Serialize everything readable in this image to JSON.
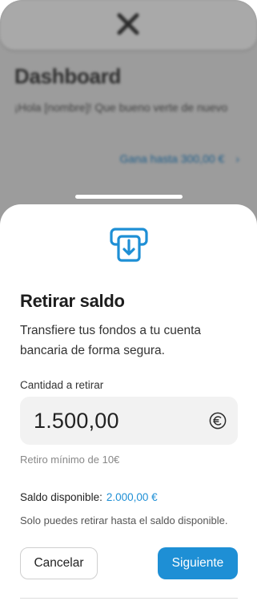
{
  "background": {
    "title": "Dashboard",
    "greeting": "¡Hola [nombre]! Que bueno verte de nuevo",
    "promo_link": "Gana hasta 300,00 €",
    "promo_chevron": "›"
  },
  "sheet": {
    "title": "Retirar saldo",
    "description": "Transfiere tus fondos a tu cuenta bancaria de forma segura.",
    "amount_label": "Cantidad a retirar",
    "amount_value": "1.500,00",
    "min_note": "Retiro mínimo de 10€",
    "balance_label": "Saldo disponible:",
    "balance_value": "2.000,00 €",
    "limit_note": "Solo puedes retirar hasta el saldo disponible.",
    "cancel_label": "Cancelar",
    "next_label": "Siguiente"
  },
  "icons": {
    "close": "close-icon",
    "withdraw": "download-tray-icon",
    "currency": "euro-icon"
  },
  "colors": {
    "accent": "#1e8fd5",
    "overlay": "#9c9c9c"
  }
}
